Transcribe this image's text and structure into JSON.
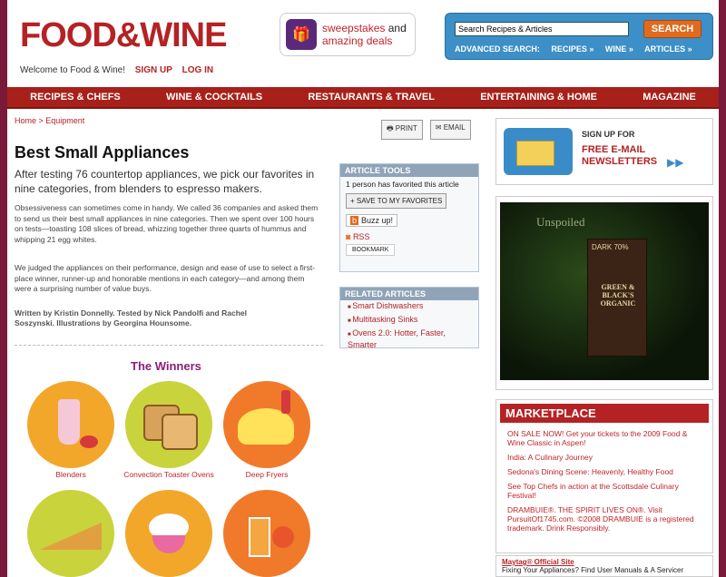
{
  "header": {
    "logo": "FOOD&WINE",
    "welcome": "Welcome to Food & Wine!",
    "signup": "SIGN UP",
    "login": "LOG IN",
    "promo_line1": "sweepstakes",
    "promo_line1b": "and",
    "promo_line2": "amazing deals",
    "search_placeholder": "Search Recipes & Articles",
    "search_button": "SEARCH",
    "advanced": "ADVANCED SEARCH:",
    "adv_recipes": "RECIPES »",
    "adv_wine": "WINE »",
    "adv_articles": "ARTICLES »"
  },
  "nav": [
    "RECIPES & CHEFS",
    "WINE & COCKTAILS",
    "RESTAURANTS & TRAVEL",
    "ENTERTAINING & HOME",
    "MAGAZINE"
  ],
  "article": {
    "breadcrumb": "Home > Equipment",
    "print": "PRINT",
    "email": "EMAIL",
    "title": "Best Small Appliances",
    "dek": "After testing 76 countertop appliances, we pick our favorites in nine categories, from blenders to espresso makers.",
    "body1": "Obsessiveness can sometimes come in handy. We called 36 companies and asked them to send us their best small appliances in nine categories. Then we spent over 100 hours on tests—toasting 108 slices of bread, whizzing together three quarts of hummus and whipping 21 egg whites.",
    "body2": "We judged the appliances on their performance, design and ease of use to select a first-place winner, runner-up and honorable mentions in each category—and among them were a surprising number of value buys.",
    "byline": "Written by Kristin Donnelly. Tested by Nick Pandolfi and Rachel Soszynski. Illustrations by Georgina Hounsome.",
    "winners_title": "The Winners",
    "winners": [
      "Blenders",
      "Convection Toaster Ovens",
      "Deep Fryers"
    ]
  },
  "tools": {
    "header": "ARTICLE TOOLS",
    "favorited": "1 person has favorited this article",
    "save": "+ SAVE TO MY FAVORITES",
    "buzz": "Buzz up!",
    "rss": "RSS",
    "bookmark": "BOOKMARK"
  },
  "related": {
    "header": "RELATED ARTICLES",
    "items": [
      "Smart Dishwashers",
      "Multitasking Sinks",
      "Ovens 2.0: Hotter, Faster, Smarter"
    ]
  },
  "newsletter": {
    "line1": "SIGN UP FOR",
    "line2": "FREE E-MAIL",
    "line3": "NEWSLETTERS"
  },
  "ad": {
    "tagline": "Unspoiled",
    "dark": "DARK 70%",
    "brand": "GREEN & BLACK'S ORGANIC"
  },
  "marketplace": {
    "header": "MARKETPLACE",
    "items": [
      "ON SALE NOW! Get your tickets to the 2009 Food & Wine Classic in Aspen!",
      "India: A Culinary Journey",
      "Sedona's Dining Scene: Heavenly, Healthy Food",
      "See Top Chefs in action at the Scottsdale Culinary Festival!",
      "DRAMBUIE®. THE SPIRIT LIVES ON®. Visit PursuitOf1745.com. ©2008 DRAMBUIE is a registered trademark. Drink Responsibly."
    ],
    "sponsor_title": "Maytag® Official Site",
    "sponsor_text": "Fixing Your Appliances? Find User Manuals & A Servicer"
  }
}
